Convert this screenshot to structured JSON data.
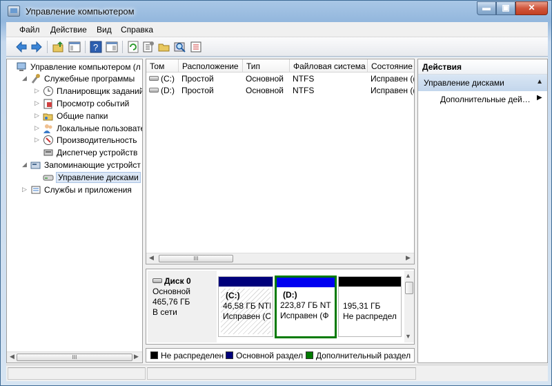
{
  "window": {
    "title": "Управление компьютером",
    "buttons": {
      "minimize": "▬",
      "maximize": "▣",
      "close": "✕"
    }
  },
  "menu": [
    "Файл",
    "Действие",
    "Вид",
    "Справка"
  ],
  "toolbar": {
    "icons": [
      "back-arrow-icon",
      "forward-arrow-icon",
      "up-folder-icon",
      "show-hide-tree-icon",
      "help-icon",
      "console-tree-icon",
      "refresh-icon",
      "properties-icon",
      "open-folder-icon",
      "search-disk-icon",
      "export-list-icon"
    ]
  },
  "tree": {
    "items": [
      {
        "label": "Управление компьютером (л",
        "arrow": "",
        "icon": "computer-management-icon"
      },
      {
        "label": "Служебные программы",
        "arrow": "◢",
        "icon": "system-tools-icon"
      },
      {
        "label": "Планировщик заданий",
        "arrow": "▷",
        "icon": "task-scheduler-icon"
      },
      {
        "label": "Просмотр событий",
        "arrow": "▷",
        "icon": "event-viewer-icon"
      },
      {
        "label": "Общие папки",
        "arrow": "▷",
        "icon": "shared-folders-icon"
      },
      {
        "label": "Локальные пользовате",
        "arrow": "▷",
        "icon": "local-users-icon"
      },
      {
        "label": "Производительность",
        "arrow": "▷",
        "icon": "performance-icon"
      },
      {
        "label": "Диспетчер устройств",
        "arrow": "",
        "icon": "device-manager-icon"
      },
      {
        "label": "Запоминающие устройст",
        "arrow": "◢",
        "icon": "storage-icon"
      },
      {
        "label": "Управление дисками",
        "arrow": "",
        "icon": "disk-management-icon"
      },
      {
        "label": "Службы и приложения",
        "arrow": "▷",
        "icon": "services-apps-icon"
      }
    ]
  },
  "volumes": {
    "columns": [
      "Том",
      "Расположение",
      "Тип",
      "Файловая система",
      "Состояние"
    ],
    "rows": [
      [
        "(C:)",
        "Простой",
        "Основной",
        "NTFS",
        "Исправен (("
      ],
      [
        "(D:)",
        "Простой",
        "Основной",
        "NTFS",
        "Исправен (("
      ]
    ]
  },
  "disk": {
    "title": "Диск 0",
    "type": "Основной",
    "size": "465,76 ГБ",
    "status": "В сети",
    "partitions": [
      {
        "name": "(C:)",
        "size": "46,58 ГБ NTF",
        "status": "Исправен (С"
      },
      {
        "name": "(D:)",
        "size": "223,87 ГБ NT",
        "status": "Исправен (Ф"
      },
      {
        "name": "",
        "size": "195,31 ГБ",
        "status": "Не распредел"
      }
    ]
  },
  "legend": [
    "Не распределен",
    "Основной раздел",
    "Дополнительный раздел"
  ],
  "colors": {
    "unallocated": "#000000",
    "primary": "#00007b",
    "extended": "#007a00",
    "logical": "#0000f0"
  },
  "actions": {
    "header": "Действия",
    "section": "Управление дисками",
    "more": "Дополнительные дей…"
  },
  "scroll": {
    "thumb": "III"
  }
}
